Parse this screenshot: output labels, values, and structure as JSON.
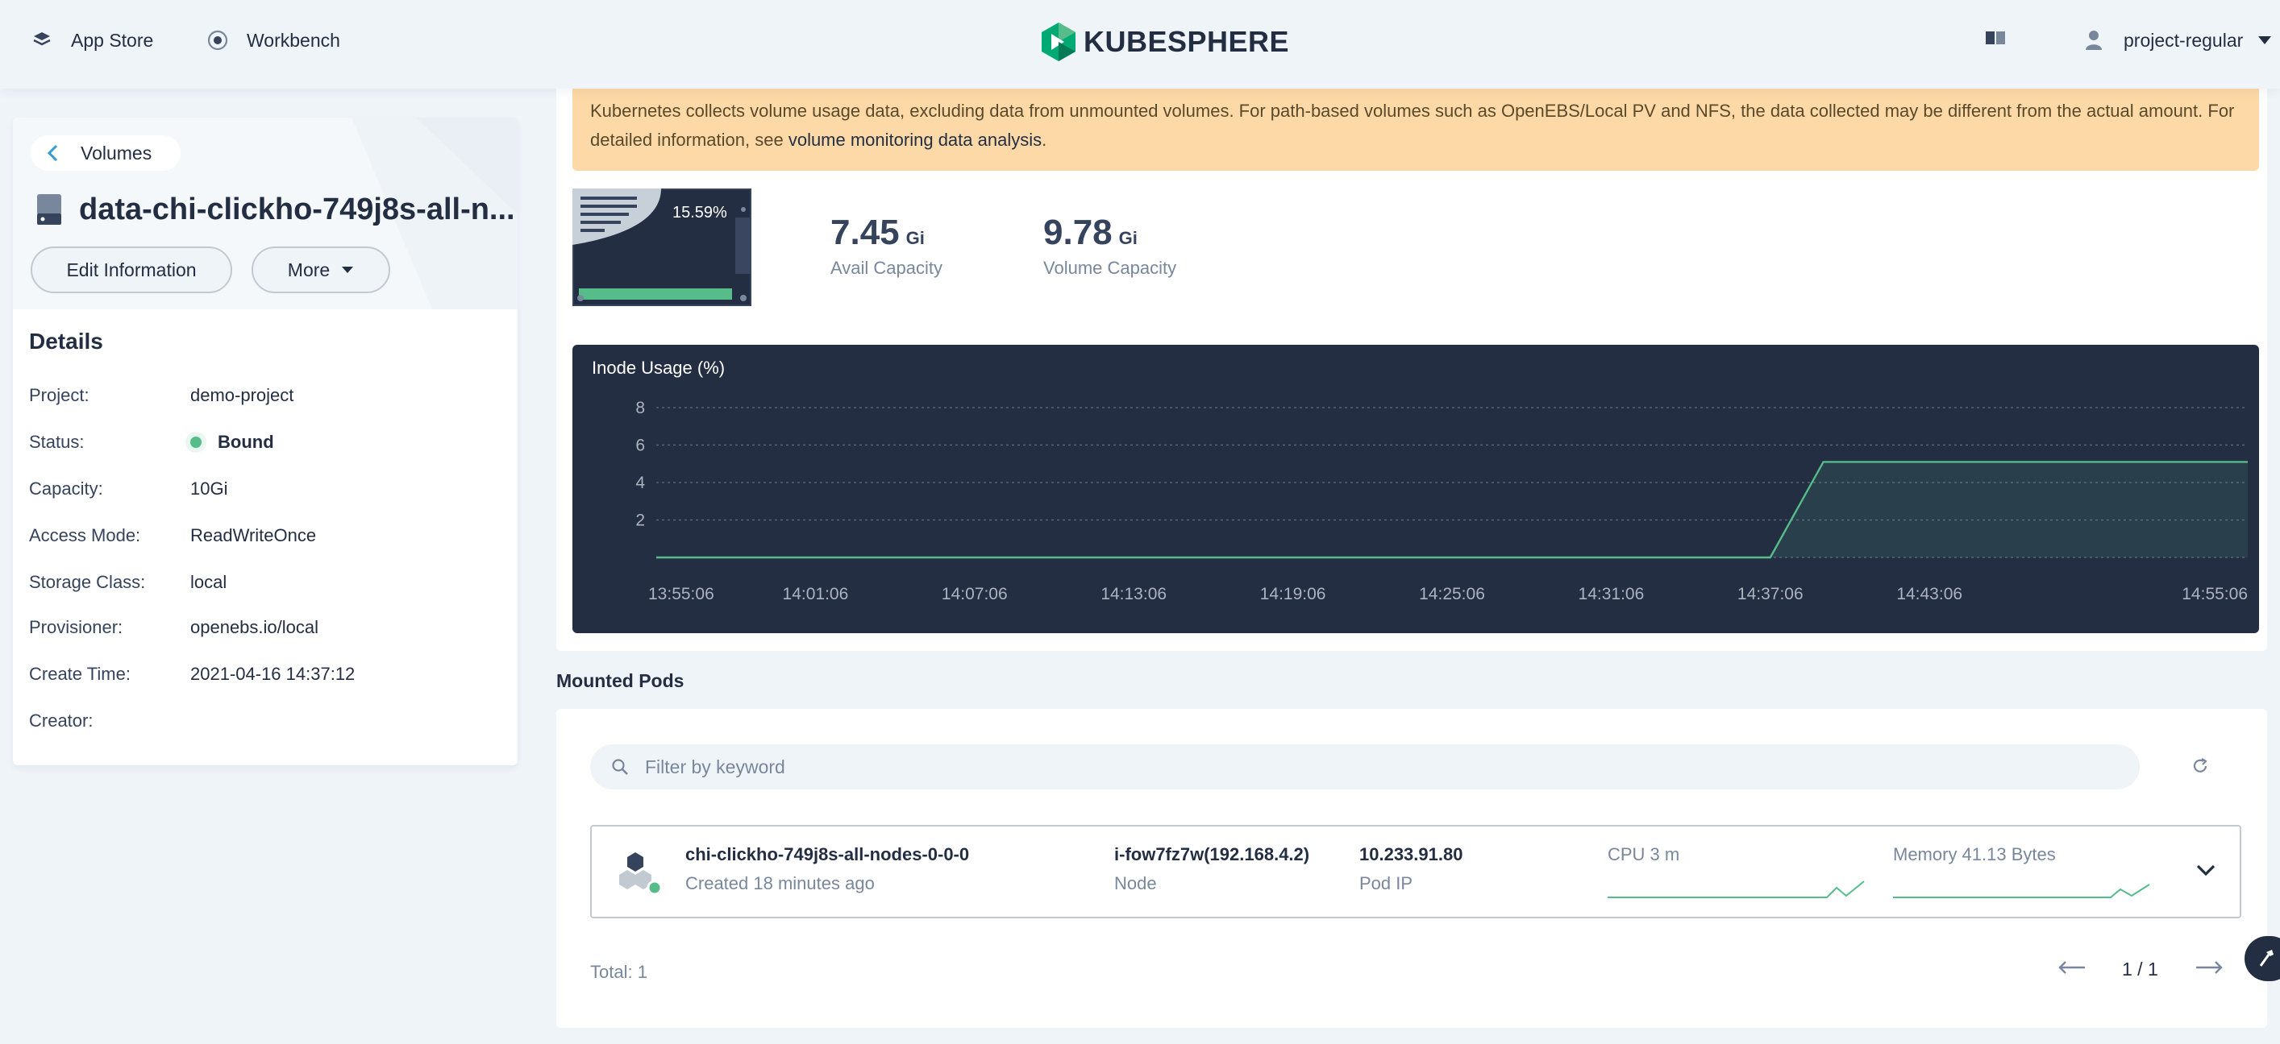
{
  "topbar": {
    "app_store": "App Store",
    "workbench": "Workbench",
    "logo_text": "KUBESPHERE",
    "user": "project-regular"
  },
  "left": {
    "back_label": "Volumes",
    "volume_name": "data-chi-clickho-749j8s-all-n...",
    "edit_button": "Edit Information",
    "more_button": "More",
    "details_title": "Details",
    "details": [
      {
        "key": "Project:",
        "value": "demo-project"
      },
      {
        "key": "Status:",
        "value": "Bound"
      },
      {
        "key": "Capacity:",
        "value": "10Gi"
      },
      {
        "key": "Access Mode:",
        "value": "ReadWriteOnce"
      },
      {
        "key": "Storage Class:",
        "value": "local"
      },
      {
        "key": "Provisioner:",
        "value": "openebs.io/local"
      },
      {
        "key": "Create Time:",
        "value": "2021-04-16 14:37:12"
      },
      {
        "key": "Creator:",
        "value": ""
      }
    ]
  },
  "notice": {
    "text": "Kubernetes collects volume usage data, excluding data from unmounted volumes. For path-based volumes such as OpenEBS/Local PV and NFS, the data collected may be different from the actual amount. For detailed information, see ",
    "link": "volume monitoring data analysis",
    "suffix": "."
  },
  "usage": {
    "percent_label": "15.59%",
    "percent": 15.59,
    "avail_value": "7.45",
    "avail_unit": "Gi",
    "avail_label": "Avail Capacity",
    "volume_value": "9.78",
    "volume_unit": "Gi",
    "volume_label": "Volume Capacity"
  },
  "chart_data": {
    "type": "area",
    "title": "Inode Usage (%)",
    "x": [
      "13:55:06",
      "14:01:06",
      "14:07:06",
      "14:13:06",
      "14:19:06",
      "14:25:06",
      "14:31:06",
      "14:37:06",
      "14:39:06",
      "14:43:06",
      "14:55:06"
    ],
    "x_ticks": [
      "13:55:06",
      "14:01:06",
      "14:07:06",
      "14:13:06",
      "14:19:06",
      "14:25:06",
      "14:31:06",
      "14:37:06",
      "14:43:06",
      "14:55:06"
    ],
    "series": [
      {
        "values": [
          0,
          0,
          0,
          0,
          0,
          0,
          0,
          0,
          5.1,
          5.1,
          5.1
        ]
      }
    ],
    "y_ticks": [
      2,
      4,
      6,
      8
    ],
    "ylim": [
      0,
      8
    ],
    "grid": true,
    "line_color": "#55bc8a"
  },
  "mounted": {
    "title": "Mounted Pods",
    "search_placeholder": "Filter by keyword",
    "pod": {
      "name": "chi-clickho-749j8s-all-nodes-0-0-0",
      "created": "Created 18 minutes ago",
      "node": "i-fow7fz7w(192.168.4.2)",
      "node_label": "Node",
      "pod_ip": "10.233.91.80",
      "pod_ip_label": "Pod IP",
      "cpu": "CPU 3 m",
      "memory": "Memory 41.13 Bytes"
    },
    "total": "Total: 1",
    "page": "1 / 1"
  }
}
